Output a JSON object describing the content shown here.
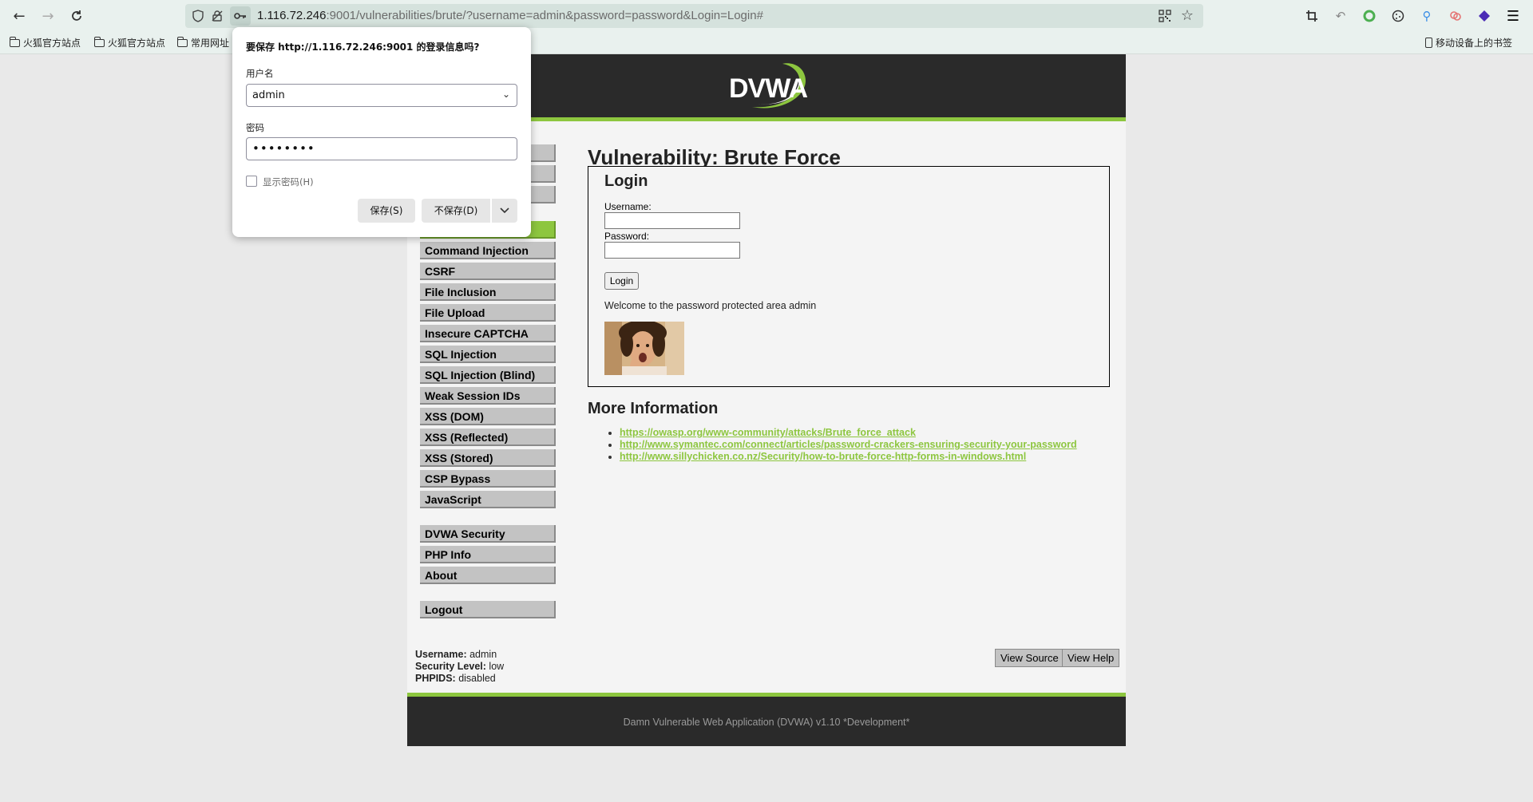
{
  "browser": {
    "url_host": "1.116.72.246",
    "url_rest": ":9001/vulnerabilities/brute/?username=admin&password=password&Login=Login#",
    "bookmarks": [
      "火狐官方站点",
      "火狐官方站点",
      "常用网址"
    ],
    "mobile_bookmarks": "移动设备上的书签"
  },
  "popup": {
    "title": "要保存 http://1.116.72.246:9001 的登录信息吗?",
    "username_label": "用户名",
    "username_value": "admin",
    "password_label": "密码",
    "password_value": "••••••••",
    "show_password_label": "显示密码(H)",
    "save_button": "保存(S)",
    "dont_save_button": "不保存(D)"
  },
  "dvwa": {
    "logo": "DVWA",
    "menu_items": [
      "Command Injection",
      "CSRF",
      "File Inclusion",
      "File Upload",
      "Insecure CAPTCHA",
      "SQL Injection",
      "SQL Injection (Blind)",
      "Weak Session IDs",
      "XSS (DOM)",
      "XSS (Reflected)",
      "XSS (Stored)",
      "CSP Bypass",
      "JavaScript"
    ],
    "menu_items_2": [
      "DVWA Security",
      "PHP Info",
      "About"
    ],
    "logout": "Logout",
    "page_title": "Vulnerability: Brute Force",
    "login_heading": "Login",
    "username_label": "Username:",
    "password_label": "Password:",
    "login_button": "Login",
    "welcome": "Welcome to the password protected area admin",
    "more_info_title": "More Information",
    "links": [
      "https://owasp.org/www-community/attacks/Brute_force_attack",
      "http://www.symantec.com/connect/articles/password-crackers-ensuring-security-your-password",
      "http://www.sillychicken.co.nz/Security/how-to-brute-force-http-forms-in-windows.html"
    ],
    "user_info": {
      "username_label": "Username:",
      "username": "admin",
      "security_label": "Security Level:",
      "security": "low",
      "phpids_label": "PHPIDS:",
      "phpids": "disabled"
    },
    "view_source": "View Source",
    "view_help": "View Help",
    "footer": "Damn Vulnerable Web Application (DVWA) v1.10 *Development*"
  }
}
